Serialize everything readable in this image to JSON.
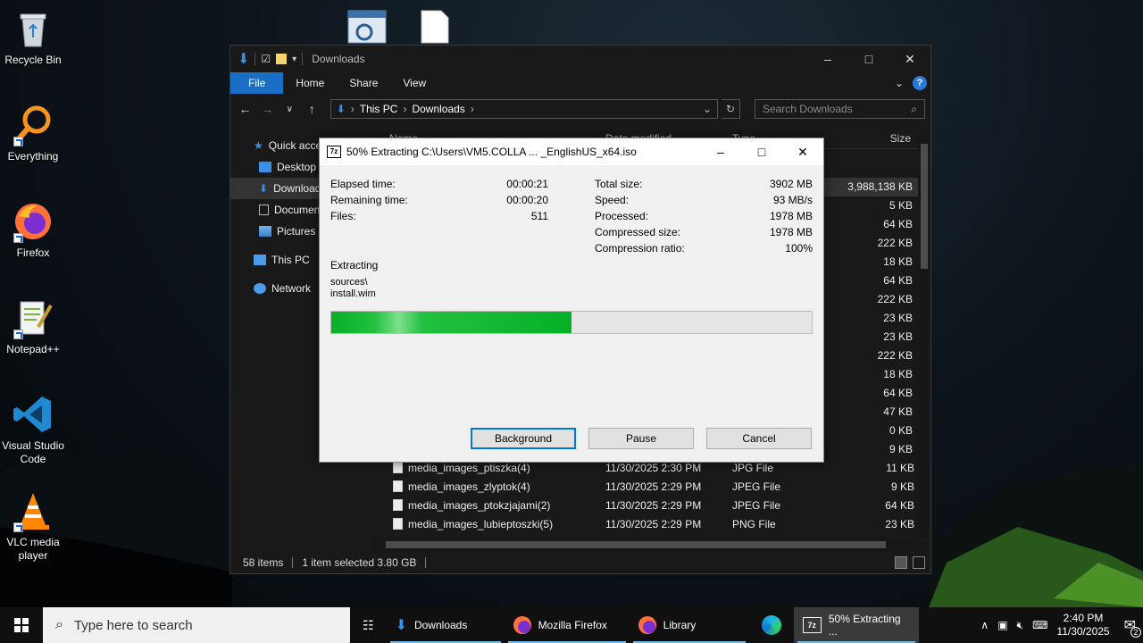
{
  "desktop": {
    "icons": [
      {
        "label": "Recycle Bin"
      },
      {
        "label": "Everything"
      },
      {
        "label": "Firefox"
      },
      {
        "label": "Notepad++"
      },
      {
        "label": "Visual Studio Code"
      },
      {
        "label": "VLC media player"
      }
    ]
  },
  "explorer": {
    "title": "Downloads",
    "ribbon": {
      "file": "File",
      "home": "Home",
      "share": "Share",
      "view": "View"
    },
    "address": {
      "root": "This PC",
      "folder": "Downloads"
    },
    "search_placeholder": "Search Downloads",
    "columns": {
      "name": "Name",
      "date": "Date modified",
      "type": "Type",
      "size": "Size"
    },
    "sidebar": [
      {
        "label": "Quick access"
      },
      {
        "label": "Desktop"
      },
      {
        "label": "Downloads"
      },
      {
        "label": "Documents"
      },
      {
        "label": "Pictures"
      },
      {
        "label": "This PC"
      },
      {
        "label": "Network"
      }
    ],
    "sizes": [
      "3,988,138 KB",
      "5 KB",
      "64 KB",
      "222 KB",
      "18 KB",
      "64 KB",
      "222 KB",
      "23 KB",
      "23 KB",
      "222 KB",
      "18 KB",
      "64 KB",
      "47 KB",
      "0 KB",
      "9 KB"
    ],
    "rows": [
      {
        "name": "media_images_ptiszka(4)",
        "date": "11/30/2025 2:30 PM",
        "type": "JPG File",
        "size": "11 KB"
      },
      {
        "name": "media_images_zlyptok(4)",
        "date": "11/30/2025 2:29 PM",
        "type": "JPEG File",
        "size": "9 KB"
      },
      {
        "name": "media_images_ptokzjajami(2)",
        "date": "11/30/2025 2:29 PM",
        "type": "JPEG File",
        "size": "64 KB"
      },
      {
        "name": "media_images_lubieptoszki(5)",
        "date": "11/30/2025 2:29 PM",
        "type": "PNG File",
        "size": "23 KB"
      }
    ],
    "status": {
      "items": "58 items",
      "selected": "1 item selected  3.80 GB"
    }
  },
  "dialog": {
    "title": "50% Extracting C:\\Users\\VM5.COLLA ... _EnglishUS_x64.iso",
    "left": [
      {
        "label": "Elapsed time:",
        "value": "00:00:21"
      },
      {
        "label": "Remaining time:",
        "value": "00:00:20"
      },
      {
        "label": "Files:",
        "value": "511"
      }
    ],
    "right": [
      {
        "label": "Total size:",
        "value": "3902 MB"
      },
      {
        "label": "Speed:",
        "value": "93 MB/s"
      },
      {
        "label": "Processed:",
        "value": "1978 MB"
      },
      {
        "label": "Compressed size:",
        "value": "1978 MB"
      },
      {
        "label": "Compression ratio:",
        "value": "100%"
      }
    ],
    "extracting_label": "Extracting",
    "path_line1": "sources\\",
    "path_line2": "install.wim",
    "progress": 0.5,
    "buttons": {
      "background": "Background",
      "pause": "Pause",
      "cancel": "Cancel"
    }
  },
  "taskbar": {
    "search_placeholder": "Type here to search",
    "items": [
      {
        "label": "Downloads"
      },
      {
        "label": "Mozilla Firefox"
      },
      {
        "label": "Library"
      },
      {
        "label": "50% Extracting ..."
      }
    ],
    "time": "2:40 PM",
    "date": "11/30/2025",
    "notifications": "2"
  },
  "colors": {
    "accent": "#1a6fc4",
    "progress": "#06b025",
    "explorer_bg": "#191919"
  }
}
